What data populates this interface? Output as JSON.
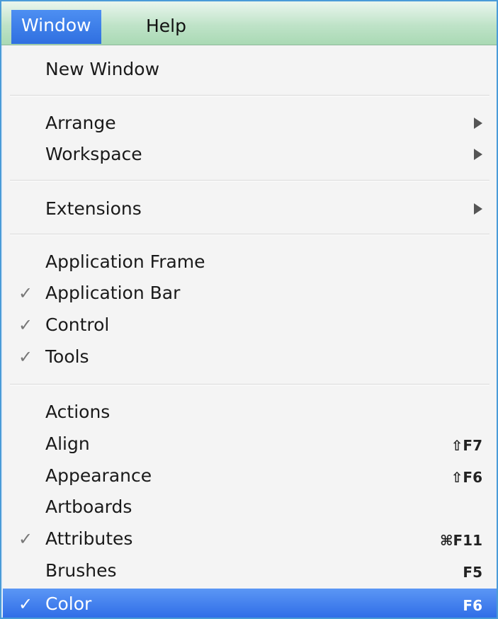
{
  "menubar": {
    "window_label": "Window",
    "help_label": "Help"
  },
  "menu": {
    "new_window": "New Window",
    "arrange": "Arrange",
    "workspace": "Workspace",
    "extensions": "Extensions",
    "application_frame": "Application Frame",
    "application_bar": "Application Bar",
    "control": "Control",
    "tools": "Tools",
    "actions": "Actions",
    "align": "Align",
    "align_shortcut": "⇧F7",
    "appearance": "Appearance",
    "appearance_shortcut": "⇧F6",
    "artboards": "Artboards",
    "attributes": "Attributes",
    "attributes_shortcut": "⌘F11",
    "brushes": "Brushes",
    "brushes_shortcut": "F5",
    "color": "Color",
    "color_shortcut": "F6",
    "check_mark": "✓"
  },
  "colors": {
    "selection": "#2d6be6",
    "menubar": "#bfe3c8",
    "frame_border": "#4a9bd8"
  }
}
